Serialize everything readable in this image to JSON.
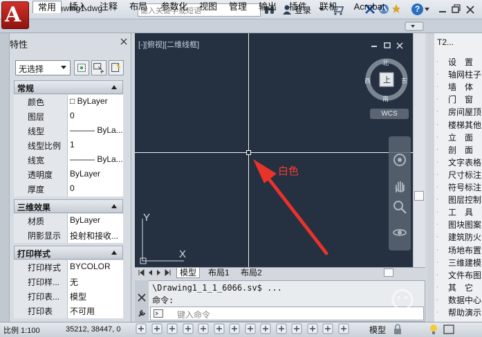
{
  "title_bar": {
    "doc_title": "Drawing1.dwg",
    "search_placeholder": "键入关键字或短语",
    "login_label": "登录",
    "help_label": "?"
  },
  "app_button_letter": "A",
  "ribbon_tabs": [
    "常用",
    "插入",
    "注释",
    "布局",
    "参数化",
    "视图",
    "管理",
    "输出",
    "插件",
    "联机",
    "Acrobat"
  ],
  "properties": {
    "header": "特性",
    "selection": "无选择",
    "sections": [
      {
        "title": "常规",
        "rows": [
          {
            "k": "颜色",
            "v": "□ ByLayer"
          },
          {
            "k": "图层",
            "v": "0"
          },
          {
            "k": "线型",
            "v": "——— ByLa..."
          },
          {
            "k": "线型比例",
            "v": "1"
          },
          {
            "k": "线宽",
            "v": "——— ByLa..."
          },
          {
            "k": "透明度",
            "v": "ByLayer"
          },
          {
            "k": "厚度",
            "v": "0"
          }
        ]
      },
      {
        "title": "三维效果",
        "rows": [
          {
            "k": "材质",
            "v": "ByLayer"
          },
          {
            "k": "阴影显示",
            "v": "投射和接收..."
          }
        ]
      },
      {
        "title": "打印样式",
        "rows": [
          {
            "k": "打印样式",
            "v": "BYCOLOR"
          },
          {
            "k": "打印样...",
            "v": "无"
          },
          {
            "k": "打印表...",
            "v": "模型"
          },
          {
            "k": "打印表",
            "v": "不可用"
          }
        ]
      }
    ]
  },
  "viewport": {
    "label": "[-][俯视][二维线框]",
    "annotation": "白色",
    "viewcube": {
      "top": "上",
      "north": "北",
      "south": "南",
      "east": "东",
      "west": "西"
    },
    "wcs": "WCS",
    "ucs_x": "X",
    "ucs_y": "Y"
  },
  "layout_tabs": [
    "模型",
    "布局1",
    "布局2"
  ],
  "command": {
    "line1": "\\Drawing1_1_1_6066.sv$ ...",
    "line2": "命令:",
    "placeholder": "键入命令"
  },
  "tool_palette": {
    "title": "T2...",
    "items": [
      "设　置",
      "轴网柱子",
      "墙　体",
      "门　窗",
      "房间屋顶",
      "楼梯其他",
      "立　面",
      "剖　面",
      "文字表格",
      "尺寸标注",
      "符号标注",
      "图层控制",
      "工　具",
      "图块图案",
      "建筑防火",
      "场地布置",
      "三维建模",
      "文件布图",
      "其　它",
      "数据中心",
      "帮助演示"
    ]
  },
  "status": {
    "scale": "比例 1:100",
    "coords": "35212, 38447, 0",
    "model": "模型"
  },
  "colors": {
    "viewport_bg": "#253041",
    "crosshair": "#f2f2f2",
    "annotation": "#ff3b30",
    "app_button": "#c4231d"
  }
}
